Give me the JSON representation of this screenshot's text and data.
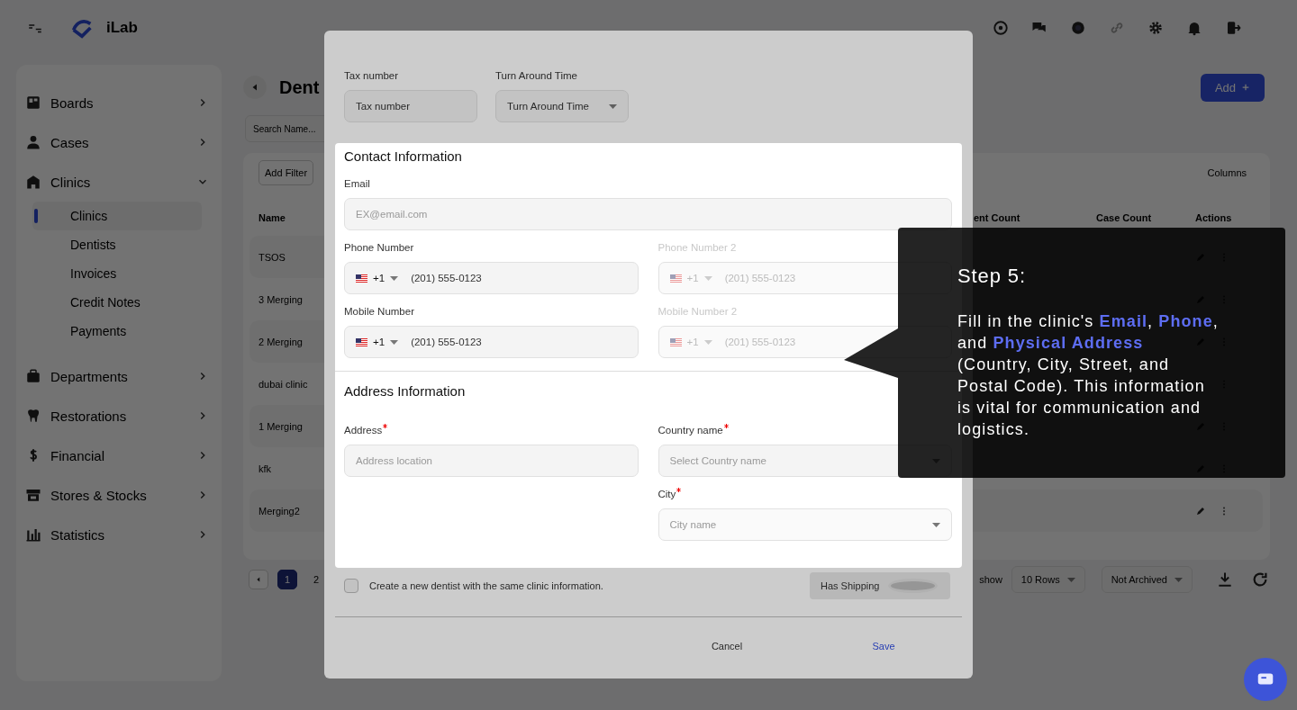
{
  "topbar": {
    "logo_text": "iLab"
  },
  "sidebar": {
    "items": [
      {
        "label": "Boards",
        "expanded": false
      },
      {
        "label": "Cases",
        "expanded": false
      },
      {
        "label": "Clinics",
        "expanded": true,
        "children": [
          {
            "label": "Clinics",
            "selected": true
          },
          {
            "label": "Dentists",
            "selected": false
          },
          {
            "label": "Invoices",
            "selected": false
          },
          {
            "label": "Credit Notes",
            "selected": false
          },
          {
            "label": "Payments",
            "selected": false
          }
        ]
      },
      {
        "label": "Departments",
        "expanded": false
      },
      {
        "label": "Restorations",
        "expanded": false
      },
      {
        "label": "Financial",
        "expanded": false
      },
      {
        "label": "Stores & Stocks",
        "expanded": false
      },
      {
        "label": "Statistics",
        "expanded": false
      }
    ]
  },
  "page": {
    "title": "Dent",
    "add_button": "Add",
    "search": {
      "placeholder": "Search Name..."
    },
    "filter_button": "Add Filter",
    "columns_button": "Columns",
    "table": {
      "columns": [
        "Name",
        "ent Count",
        "Case Count",
        "Actions"
      ],
      "rows": [
        {
          "name": "TSOS"
        },
        {
          "name": "3 Merging"
        },
        {
          "name": "2 Merging"
        },
        {
          "name": "dubai clinic"
        },
        {
          "name": "1 Merging"
        },
        {
          "name": "kfk"
        },
        {
          "name": "Merging2"
        }
      ]
    },
    "pages": [
      {
        "label": "1",
        "selected": true
      },
      {
        "label": "2",
        "selected": false
      }
    ],
    "rows_select": {
      "label": "show",
      "value": "10 Rows"
    },
    "archive_select": {
      "value": "Not Archived"
    }
  },
  "dialog": {
    "tax": {
      "label": "Tax number",
      "placeholder": "Tax number"
    },
    "turnaround": {
      "label": "Turn Around Time",
      "placeholder": "Turn Around Time"
    },
    "contact": {
      "title": "Contact Information",
      "email": {
        "label": "Email",
        "placeholder": "EX@email.com"
      },
      "phones": [
        {
          "label": "Phone Number",
          "code": "+1",
          "value": "(201) 555-0123",
          "disabled": false
        },
        {
          "label": "Phone Number 2",
          "code": "+1",
          "placeholder": "(201) 555-0123",
          "disabled": true
        },
        {
          "label": "Mobile Number",
          "code": "+1",
          "value": "(201) 555-0123",
          "disabled": false
        },
        {
          "label": "Mobile Number 2",
          "code": "+1",
          "placeholder": "(201) 555-0123",
          "disabled": true
        }
      ]
    },
    "address": {
      "title": "Address Information",
      "address": {
        "label": "Address",
        "required": true,
        "placeholder": "Address location"
      },
      "country": {
        "label": "Country name",
        "required": true,
        "placeholder": "Select Country name"
      },
      "city": {
        "label": "City",
        "required": true,
        "placeholder": "City name"
      }
    },
    "create_dentist": {
      "label": "Create a new dentist with the same clinic information.",
      "checked": false
    },
    "has_shipping": {
      "label": "Has Shipping",
      "on": false
    },
    "buttons": [
      "Cancel",
      "Save"
    ]
  },
  "tooltip": {
    "title": "Step 5:",
    "body": "Fill in the clinic's **Email**, **Phone**, and **Physical Address** (Country, City, Street, and Postal Code). This information is vital for communication and logistics."
  }
}
